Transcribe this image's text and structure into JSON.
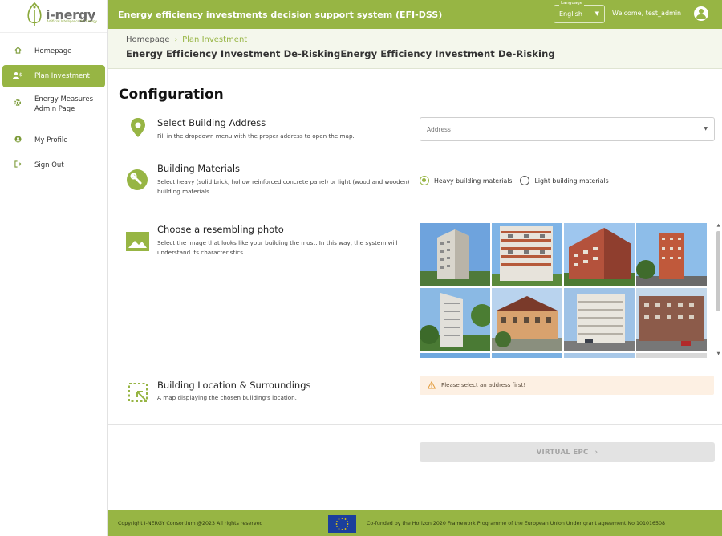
{
  "app": {
    "logo_text": "i-nergy",
    "logo_subtitle": "Artificial Intelligence for Energy",
    "collapse_glyph": "‹",
    "title": "Energy efficiency investments decision support system (EFI-DSS)"
  },
  "sidebar": {
    "items": [
      {
        "label": "Homepage",
        "icon": "home-icon",
        "active": false
      },
      {
        "label": "Plan Investment",
        "icon": "investment-icon",
        "active": true
      },
      {
        "label": "Energy Measures Admin Page",
        "icon": "gear-icon",
        "active": false
      },
      {
        "label": "My Profile",
        "icon": "user-icon",
        "active": false
      },
      {
        "label": "Sign Out",
        "icon": "sign-out-icon",
        "active": false
      }
    ]
  },
  "header": {
    "language_label": "Language",
    "language_value": "English",
    "welcome": "Welcome, test_admin"
  },
  "breadcrumb": {
    "home": "Homepage",
    "current": "Plan Investment",
    "heading": "Energy Efficiency Investment De-RiskingEnergy Efficiency Investment De-Risking"
  },
  "main": {
    "title": "Configuration",
    "address": {
      "title": "Select Building Address",
      "description": "Fill in the dropdown menu with the proper address to open the map.",
      "placeholder": "Address"
    },
    "materials": {
      "title": "Building Materials",
      "description": "Select heavy (solid brick, hollow reinforced concrete panel) or light (wood and wooden) building materials.",
      "options": [
        "Heavy building materials",
        "Light building materials"
      ],
      "selected": "Heavy building materials"
    },
    "photo": {
      "title": "Choose a resembling photo",
      "description": "Select the image that looks like your building the most. In this way, the system will understand its characteristics."
    },
    "location": {
      "title": "Building Location & Surroundings",
      "description": "A map displaying the chosen building's location.",
      "warning": "Please select an address first!"
    },
    "epc_button": "VIRTUAL EPC",
    "epc_chevron": "›"
  },
  "footer": {
    "copyright": "Copyright I-NERGY Consortium @2023 All rights reserved",
    "funding": "Co-funded by the Horizon 2020 Framework Programme of the European Union Under grant agreement No 101016508"
  },
  "colors": {
    "brand_green": "#97b544",
    "warning_bg": "#fdf0e3",
    "eu_blue": "#1b3f9c"
  }
}
